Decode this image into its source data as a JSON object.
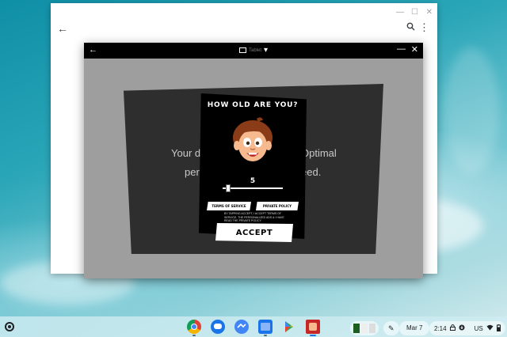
{
  "desktop": {
    "wallpaper": "ocean-aerial"
  },
  "background_window": {
    "controls": {
      "minimize": "—",
      "maximize": "☐",
      "close": "✕"
    },
    "back_icon": "←",
    "search_icon": "search-icon",
    "menu_icon": "⋮",
    "partial_text_line1_left": "Your d",
    "partial_text_line1_right": "Optimal",
    "partial_text_line2_left": "per",
    "partial_text_line2_right": "eed."
  },
  "app_window": {
    "title_label": "Tablet",
    "title_caret": "▾",
    "back_icon": "←",
    "minimize": "—",
    "close": "✕"
  },
  "age_dialog": {
    "title": "HOW OLD ARE YOU?",
    "age_value": "5",
    "slider": {
      "min": 0,
      "max": 100,
      "value": 5
    },
    "terms_button": "TERMS OF SERVICE",
    "privacy_button": "PRIVATE POLICY",
    "consent_text": "BY TAPPING ACCEPT, I ACCEPT TERMS OF SERVICE. THE PERSONALIZED ADS & I HAVE READ THE PRIVATE POLICY.",
    "accept_button": "ACCEPT"
  },
  "shelf": {
    "apps": [
      {
        "name": "chrome",
        "color": "#db4437"
      },
      {
        "name": "messages",
        "color": "#1a73e8"
      },
      {
        "name": "app-3",
        "color": "#4285f4"
      },
      {
        "name": "files",
        "color": "#1a73e8"
      },
      {
        "name": "play-store",
        "color": "#34a853"
      },
      {
        "name": "game-app",
        "color": "#c62828"
      }
    ],
    "date": "Mar 7",
    "time": "2:14",
    "locale": "US"
  }
}
